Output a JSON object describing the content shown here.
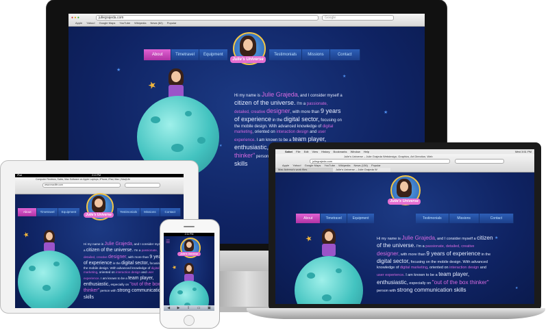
{
  "site": {
    "url": "juliegrajeda.com",
    "logo_text": "Julie's Universe",
    "nav": [
      "About",
      "Timetravel",
      "Equipment",
      "Testimonials",
      "Missions",
      "Contact"
    ],
    "bio": {
      "p1": "Hi my name is",
      "name": "Julie Grajeda",
      "p2": ", and I consider myself a",
      "citizen": "citizen of the universe.",
      "p3": "I'm a",
      "passionate": "passionate, detailed, creative",
      "designer": "designer",
      "p4": ", with more than",
      "years": "9 years of experience",
      "p5": "in the",
      "sector": "digital sector,",
      "p6": "focusing on the mobile design. With advanced knowledge of",
      "marketing": "digital marketing",
      "p7": ", oriented on",
      "interaction": "interaction design",
      "p8": "and",
      "ux": "user experience",
      "p9": ". I am known to be a",
      "team": "team player,",
      "enthusiastic": "enthusiastic,",
      "p10": "especially on",
      "outbox": "\"out of the box thinker\"",
      "p11": "person with",
      "skills": "strong communication skills"
    }
  },
  "imac_browser": {
    "bookmarks": [
      "Apple",
      "Yahoo!",
      "Google Maps",
      "YouTube",
      "Wikipedia",
      "News (82)",
      "Popular"
    ],
    "search_placeholder": "Google"
  },
  "laptop_browser": {
    "menu": [
      "Safari",
      "File",
      "Edit",
      "View",
      "History",
      "Bookmarks",
      "Window",
      "Help"
    ],
    "window_title": "Julie's Universe – Julie Grajeda Webdesign, Graphics, Art Direction, Web",
    "clock": "Wed 3:51 PM",
    "bookmarks": [
      "Apple",
      "Yahoo!",
      "Google Maps",
      "YouTube",
      "Wikipedia",
      "News (136)",
      "Popular"
    ],
    "tabs": [
      "Mac Actress's work files",
      "Julie's Universe – Julie Grajeda W"
    ]
  },
  "ipad_browser": {
    "status_left": "iPad",
    "status_time": "2:13 PM",
    "title": "Computer Reviews, Sales, Mac Software on Apple Laptops, iPhone, iPad, Mac | Mac|Life",
    "url": "www.maclife.com"
  },
  "iphone_browser": {
    "status_time": "2:11 PM",
    "menu_symbol": "☰"
  },
  "colors": {
    "bg_navy": "#0f2363",
    "nav_blue": "#2d5fb8",
    "nav_active_pink": "#d04fc4",
    "highlight_pink": "#d76ae0",
    "planet_teal": "#43c3c0",
    "logo_gold": "#f3c545"
  }
}
